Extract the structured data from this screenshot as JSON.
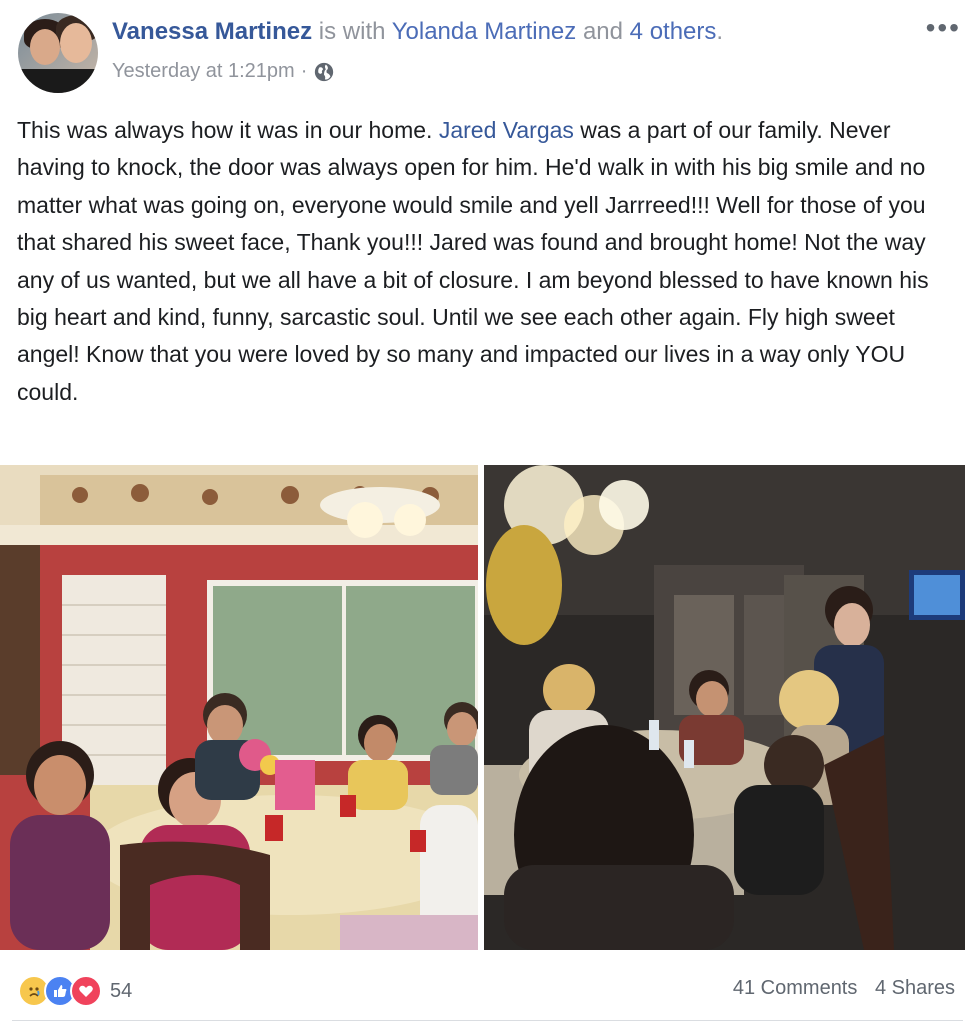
{
  "post": {
    "author": "Vanessa Martinez",
    "with_text": " is with ",
    "tagged_first": "Yolanda Martinez",
    "and_text": " and ",
    "tagged_others": "4 others",
    "period": ".",
    "timestamp": "Yesterday at 1:21pm",
    "separator": "·",
    "privacy_icon": "globe-icon",
    "more_label": "•••",
    "body_part1": "This was always how it was in our home. ",
    "body_link": "Jared Vargas",
    "body_part2": " was a part of our family. Never having to knock, the door was always open for him. He'd walk in with his big smile and no matter what was going on, everyone would smile and yell Jarrreed!!! Well for those of you that shared his sweet face, Thank you!!! Jared was found and brought home! Not the way any of us wanted, but we all have a bit of closure. I am beyond blessed to have known his big heart and kind, funny, sarcastic soul. Until we see each other again. Fly high sweet angel! Know that you were loved by so many and impacted our lives in a way only YOU could."
  },
  "photos": [
    {
      "name": "dining-room-photo-daylight"
    },
    {
      "name": "dining-room-photo-evening"
    }
  ],
  "footer": {
    "reactions": [
      "sad-reaction-icon",
      "like-reaction-icon",
      "love-reaction-icon"
    ],
    "reaction_count": "54",
    "comments": "41 Comments",
    "shares": "4 Shares"
  },
  "colors": {
    "link": "#365899",
    "meta_gray": "#90949c",
    "like_blue": "#4b82f2",
    "love_red": "#f0435c",
    "sad_yellow": "#f7c74d"
  }
}
